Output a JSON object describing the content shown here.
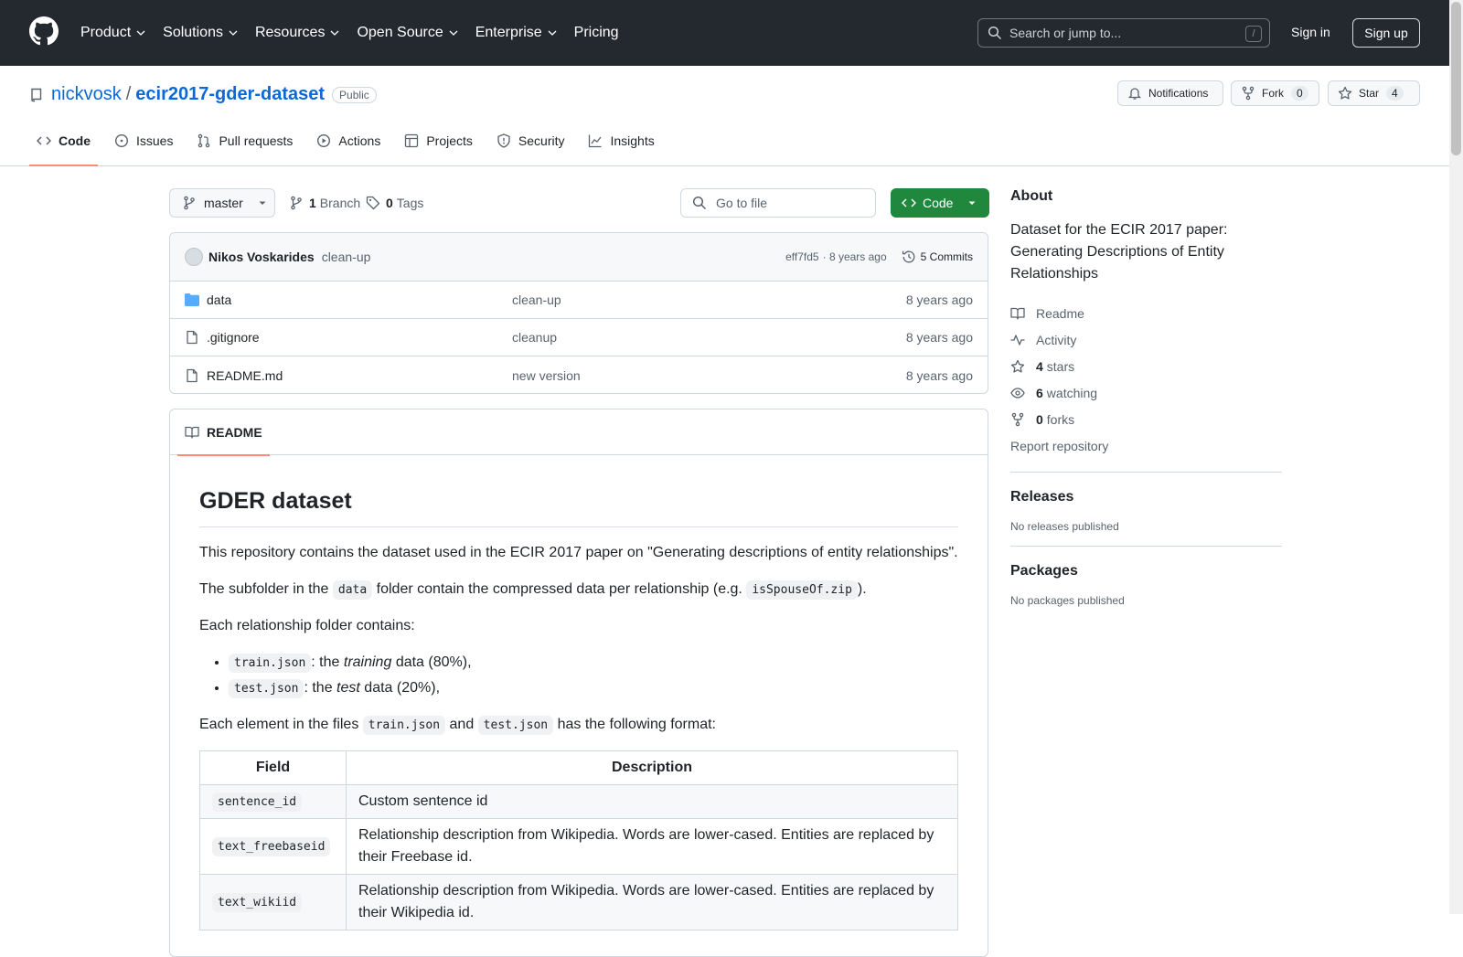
{
  "header": {
    "nav": [
      "Product",
      "Solutions",
      "Resources",
      "Open Source",
      "Enterprise",
      "Pricing"
    ],
    "search_placeholder": "Search or jump to...",
    "search_shortcut": "/",
    "signin": "Sign in",
    "signup": "Sign up"
  },
  "repo": {
    "owner": "nickvosk",
    "separator": "/",
    "name": "ecir2017-gder-dataset",
    "visibility": "Public",
    "notifications": "Notifications",
    "fork_label": "Fork",
    "fork_count": "0",
    "star_label": "Star",
    "star_count": "4",
    "tabs": [
      "Code",
      "Issues",
      "Pull requests",
      "Actions",
      "Projects",
      "Security",
      "Insights"
    ]
  },
  "toolbar": {
    "branch": "master",
    "branch_count": "1",
    "branch_label": "Branch",
    "tag_count": "0",
    "tag_label": "Tags",
    "goto_placeholder": "Go to file",
    "code_label": "Code"
  },
  "commit": {
    "author": "Nikos Voskarides",
    "message": "clean-up",
    "sha": "eff7fd5",
    "age": "· 8 years ago",
    "commits": "5 Commits"
  },
  "files": [
    {
      "type": "folder",
      "name": "data",
      "message": "clean-up",
      "age": "8 years ago"
    },
    {
      "type": "file",
      "name": ".gitignore",
      "message": "cleanup",
      "age": "8 years ago"
    },
    {
      "type": "file",
      "name": "README.md",
      "message": "new version",
      "age": "8 years ago"
    }
  ],
  "readme": {
    "tab": "README",
    "title": "GDER dataset",
    "p1": "This repository contains the dataset used in the ECIR 2017 paper on \"Generating descriptions of entity relationships\".",
    "p2_a": "The subfolder in the",
    "p2_code1": "data",
    "p2_b": "folder contain the compressed data per relationship (e.g.",
    "p2_code2": "isSpouseOf.zip",
    "p2_c": ").",
    "p3": "Each relationship folder contains:",
    "li1_code": "train.json",
    "li1_a": ": the",
    "li1_em": "training",
    "li1_b": "data (80%),",
    "li2_code": "test.json",
    "li2_a": ": the",
    "li2_em": "test",
    "li2_b": "data (20%),",
    "p4_a": "Each element in the files",
    "p4_code1": "train.json",
    "p4_b": "and",
    "p4_code2": "test.json",
    "p4_c": "has the following format:",
    "table": {
      "headers": [
        "Field",
        "Description"
      ],
      "rows": [
        {
          "field": "sentence_id",
          "desc": "Custom sentence id"
        },
        {
          "field": "text_freebaseid",
          "desc": "Relationship description from Wikipedia. Words are lower-cased. Entities are replaced by their Freebase id."
        },
        {
          "field": "text_wikiid",
          "desc": "Relationship description from Wikipedia. Words are lower-cased. Entities are replaced by their Wikipedia id."
        }
      ]
    }
  },
  "sidebar": {
    "about_title": "About",
    "description": "Dataset for the ECIR 2017 paper: Generating Descriptions of Entity Relationships",
    "readme": "Readme",
    "activity": "Activity",
    "stars_count": "4",
    "stars_label": "stars",
    "watching_count": "6",
    "watching_label": "watching",
    "forks_count": "0",
    "forks_label": "forks",
    "report": "Report repository",
    "releases_title": "Releases",
    "releases_text": "No releases published",
    "packages_title": "Packages",
    "packages_text": "No packages published"
  },
  "colors": {
    "header_bg": "#24292f",
    "link": "#0969da",
    "green": "#1f883d",
    "tab_underline": "#fd8c73"
  }
}
